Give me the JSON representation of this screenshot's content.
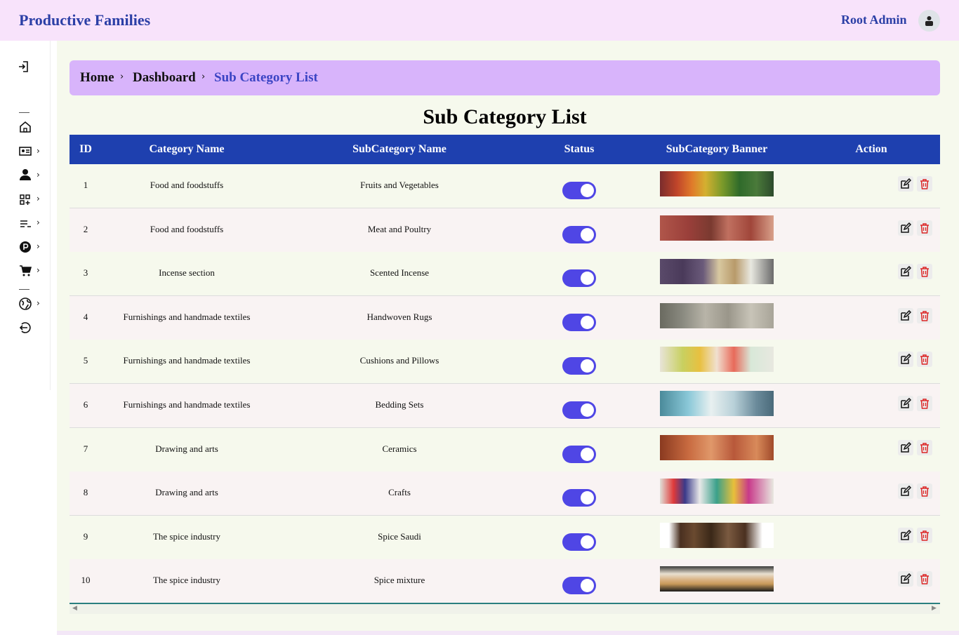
{
  "app": {
    "title": "Productive Families"
  },
  "header": {
    "user_name": "Root Admin"
  },
  "breadcrumb": {
    "home": "Home",
    "dashboard": "Dashboard",
    "current": "Sub Category List"
  },
  "page": {
    "title": "Sub Category List"
  },
  "table": {
    "columns": {
      "id": "ID",
      "category": "Category Name",
      "subcategory": "SubCategory Name",
      "status": "Status",
      "banner": "SubCategory Banner",
      "action": "Action"
    },
    "rows": [
      {
        "id": "1",
        "category": "Food and foodstuffs",
        "subcategory": "Fruits and Vegetables",
        "status": true
      },
      {
        "id": "2",
        "category": "Food and foodstuffs",
        "subcategory": "Meat and Poultry",
        "status": true
      },
      {
        "id": "3",
        "category": "Incense section",
        "subcategory": "Scented Incense",
        "status": true
      },
      {
        "id": "4",
        "category": "Furnishings and handmade textiles",
        "subcategory": "Handwoven Rugs",
        "status": true
      },
      {
        "id": "5",
        "category": "Furnishings and handmade textiles",
        "subcategory": "Cushions and Pillows",
        "status": true
      },
      {
        "id": "6",
        "category": "Furnishings and handmade textiles",
        "subcategory": "Bedding Sets",
        "status": true
      },
      {
        "id": "7",
        "category": "Drawing and arts",
        "subcategory": "Ceramics",
        "status": true
      },
      {
        "id": "8",
        "category": "Drawing and arts",
        "subcategory": "Crafts",
        "status": true
      },
      {
        "id": "9",
        "category": "The spice industry",
        "subcategory": "Spice Saudi",
        "status": true
      },
      {
        "id": "10",
        "category": "The spice industry",
        "subcategory": "Spice mixture",
        "status": true
      }
    ]
  },
  "sidebar": {
    "icons": [
      "login-icon",
      "home-icon",
      "id-card-icon",
      "user-icon",
      "apps-add-icon",
      "list-icon",
      "parking-icon",
      "cart-icon",
      "globe-icon",
      "logout-icon"
    ]
  },
  "colors": {
    "brand": "#2b3fa6",
    "header_bg": "#1e40af",
    "toggle": "#4f46e5",
    "delete": "#dc2626"
  }
}
